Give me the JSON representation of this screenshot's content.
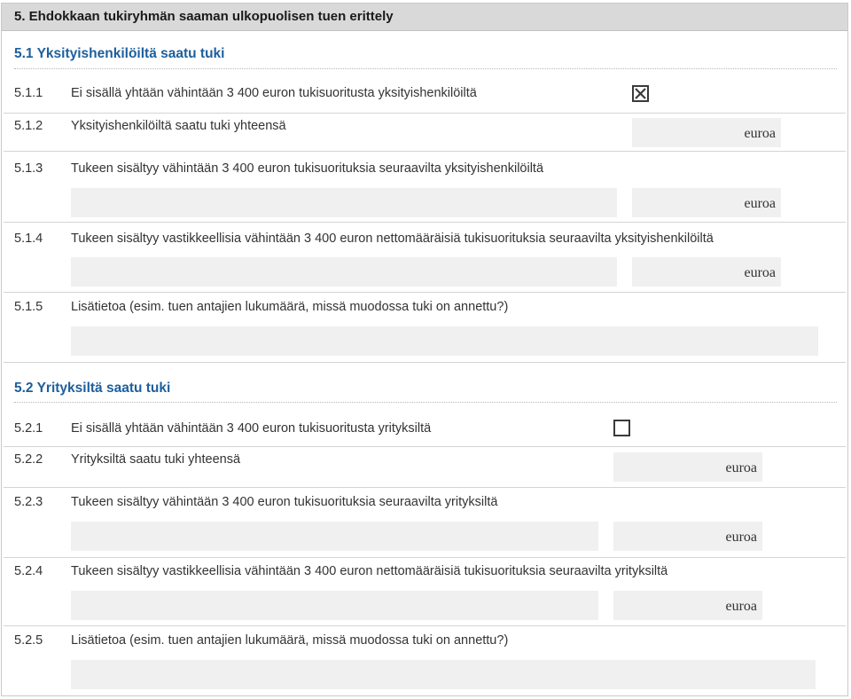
{
  "header": {
    "title": "5. Ehdokkaan tukiryhmän saaman ulkopuolisen tuen erittely"
  },
  "sections": [
    {
      "title": "5.1 Yksityishenkilöiltä saatu tuki",
      "rows": [
        {
          "num": "5.1.1",
          "label": "Ei sisällä yhtään vähintään 3 400 euron tukisuoritusta yksityishenkilöiltä",
          "checked": true
        },
        {
          "num": "5.1.2",
          "label": "Yksityishenkilöiltä saatu tuki yhteensä",
          "unit": "euroa"
        },
        {
          "num": "5.1.3",
          "label": "Tukeen sisältyy vähintään 3 400 euron tukisuorituksia seuraavilta yksityishenkilöiltä",
          "unit": "euroa"
        },
        {
          "num": "5.1.4",
          "label": "Tukeen sisältyy vastikkeellisia vähintään 3 400 euron nettomääräisiä tukisuorituksia seuraavilta yksityishenkilöiltä",
          "unit": "euroa"
        },
        {
          "num": "5.1.5",
          "label": "Lisätietoa (esim. tuen antajien lukumäärä, missä muodossa tuki on annettu?)"
        }
      ]
    },
    {
      "title": "5.2 Yrityksiltä saatu tuki",
      "rows": [
        {
          "num": "5.2.1",
          "label": "Ei sisällä yhtään vähintään 3 400 euron tukisuoritusta yrityksiltä",
          "checked": false
        },
        {
          "num": "5.2.2",
          "label": "Yrityksiltä saatu tuki yhteensä",
          "unit": "euroa"
        },
        {
          "num": "5.2.3",
          "label": "Tukeen sisältyy vähintään 3 400 euron tukisuorituksia seuraavilta yrityksiltä",
          "unit": "euroa"
        },
        {
          "num": "5.2.4",
          "label": "Tukeen sisältyy vastikkeellisia vähintään 3 400 euron nettomääräisiä tukisuorituksia seuraavilta yrityksiltä",
          "unit": "euroa"
        },
        {
          "num": "5.2.5",
          "label": "Lisätietoa (esim. tuen antajien lukumäärä, missä muodossa tuki on annettu?)"
        }
      ]
    }
  ]
}
